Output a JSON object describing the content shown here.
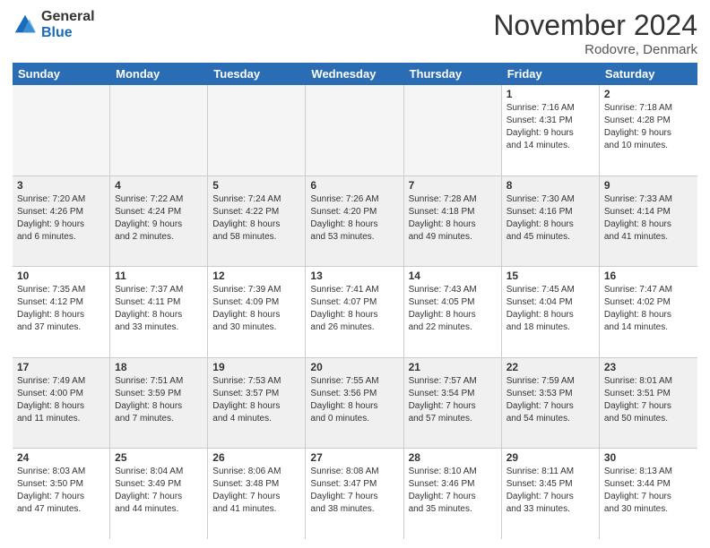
{
  "logo": {
    "general": "General",
    "blue": "Blue"
  },
  "header": {
    "month": "November 2024",
    "location": "Rodovre, Denmark"
  },
  "weekdays": [
    "Sunday",
    "Monday",
    "Tuesday",
    "Wednesday",
    "Thursday",
    "Friday",
    "Saturday"
  ],
  "weeks": [
    [
      {
        "day": "",
        "info": ""
      },
      {
        "day": "",
        "info": ""
      },
      {
        "day": "",
        "info": ""
      },
      {
        "day": "",
        "info": ""
      },
      {
        "day": "",
        "info": ""
      },
      {
        "day": "1",
        "info": "Sunrise: 7:16 AM\nSunset: 4:31 PM\nDaylight: 9 hours\nand 14 minutes."
      },
      {
        "day": "2",
        "info": "Sunrise: 7:18 AM\nSunset: 4:28 PM\nDaylight: 9 hours\nand 10 minutes."
      }
    ],
    [
      {
        "day": "3",
        "info": "Sunrise: 7:20 AM\nSunset: 4:26 PM\nDaylight: 9 hours\nand 6 minutes."
      },
      {
        "day": "4",
        "info": "Sunrise: 7:22 AM\nSunset: 4:24 PM\nDaylight: 9 hours\nand 2 minutes."
      },
      {
        "day": "5",
        "info": "Sunrise: 7:24 AM\nSunset: 4:22 PM\nDaylight: 8 hours\nand 58 minutes."
      },
      {
        "day": "6",
        "info": "Sunrise: 7:26 AM\nSunset: 4:20 PM\nDaylight: 8 hours\nand 53 minutes."
      },
      {
        "day": "7",
        "info": "Sunrise: 7:28 AM\nSunset: 4:18 PM\nDaylight: 8 hours\nand 49 minutes."
      },
      {
        "day": "8",
        "info": "Sunrise: 7:30 AM\nSunset: 4:16 PM\nDaylight: 8 hours\nand 45 minutes."
      },
      {
        "day": "9",
        "info": "Sunrise: 7:33 AM\nSunset: 4:14 PM\nDaylight: 8 hours\nand 41 minutes."
      }
    ],
    [
      {
        "day": "10",
        "info": "Sunrise: 7:35 AM\nSunset: 4:12 PM\nDaylight: 8 hours\nand 37 minutes."
      },
      {
        "day": "11",
        "info": "Sunrise: 7:37 AM\nSunset: 4:11 PM\nDaylight: 8 hours\nand 33 minutes."
      },
      {
        "day": "12",
        "info": "Sunrise: 7:39 AM\nSunset: 4:09 PM\nDaylight: 8 hours\nand 30 minutes."
      },
      {
        "day": "13",
        "info": "Sunrise: 7:41 AM\nSunset: 4:07 PM\nDaylight: 8 hours\nand 26 minutes."
      },
      {
        "day": "14",
        "info": "Sunrise: 7:43 AM\nSunset: 4:05 PM\nDaylight: 8 hours\nand 22 minutes."
      },
      {
        "day": "15",
        "info": "Sunrise: 7:45 AM\nSunset: 4:04 PM\nDaylight: 8 hours\nand 18 minutes."
      },
      {
        "day": "16",
        "info": "Sunrise: 7:47 AM\nSunset: 4:02 PM\nDaylight: 8 hours\nand 14 minutes."
      }
    ],
    [
      {
        "day": "17",
        "info": "Sunrise: 7:49 AM\nSunset: 4:00 PM\nDaylight: 8 hours\nand 11 minutes."
      },
      {
        "day": "18",
        "info": "Sunrise: 7:51 AM\nSunset: 3:59 PM\nDaylight: 8 hours\nand 7 minutes."
      },
      {
        "day": "19",
        "info": "Sunrise: 7:53 AM\nSunset: 3:57 PM\nDaylight: 8 hours\nand 4 minutes."
      },
      {
        "day": "20",
        "info": "Sunrise: 7:55 AM\nSunset: 3:56 PM\nDaylight: 8 hours\nand 0 minutes."
      },
      {
        "day": "21",
        "info": "Sunrise: 7:57 AM\nSunset: 3:54 PM\nDaylight: 7 hours\nand 57 minutes."
      },
      {
        "day": "22",
        "info": "Sunrise: 7:59 AM\nSunset: 3:53 PM\nDaylight: 7 hours\nand 54 minutes."
      },
      {
        "day": "23",
        "info": "Sunrise: 8:01 AM\nSunset: 3:51 PM\nDaylight: 7 hours\nand 50 minutes."
      }
    ],
    [
      {
        "day": "24",
        "info": "Sunrise: 8:03 AM\nSunset: 3:50 PM\nDaylight: 7 hours\nand 47 minutes."
      },
      {
        "day": "25",
        "info": "Sunrise: 8:04 AM\nSunset: 3:49 PM\nDaylight: 7 hours\nand 44 minutes."
      },
      {
        "day": "26",
        "info": "Sunrise: 8:06 AM\nSunset: 3:48 PM\nDaylight: 7 hours\nand 41 minutes."
      },
      {
        "day": "27",
        "info": "Sunrise: 8:08 AM\nSunset: 3:47 PM\nDaylight: 7 hours\nand 38 minutes."
      },
      {
        "day": "28",
        "info": "Sunrise: 8:10 AM\nSunset: 3:46 PM\nDaylight: 7 hours\nand 35 minutes."
      },
      {
        "day": "29",
        "info": "Sunrise: 8:11 AM\nSunset: 3:45 PM\nDaylight: 7 hours\nand 33 minutes."
      },
      {
        "day": "30",
        "info": "Sunrise: 8:13 AM\nSunset: 3:44 PM\nDaylight: 7 hours\nand 30 minutes."
      }
    ]
  ]
}
